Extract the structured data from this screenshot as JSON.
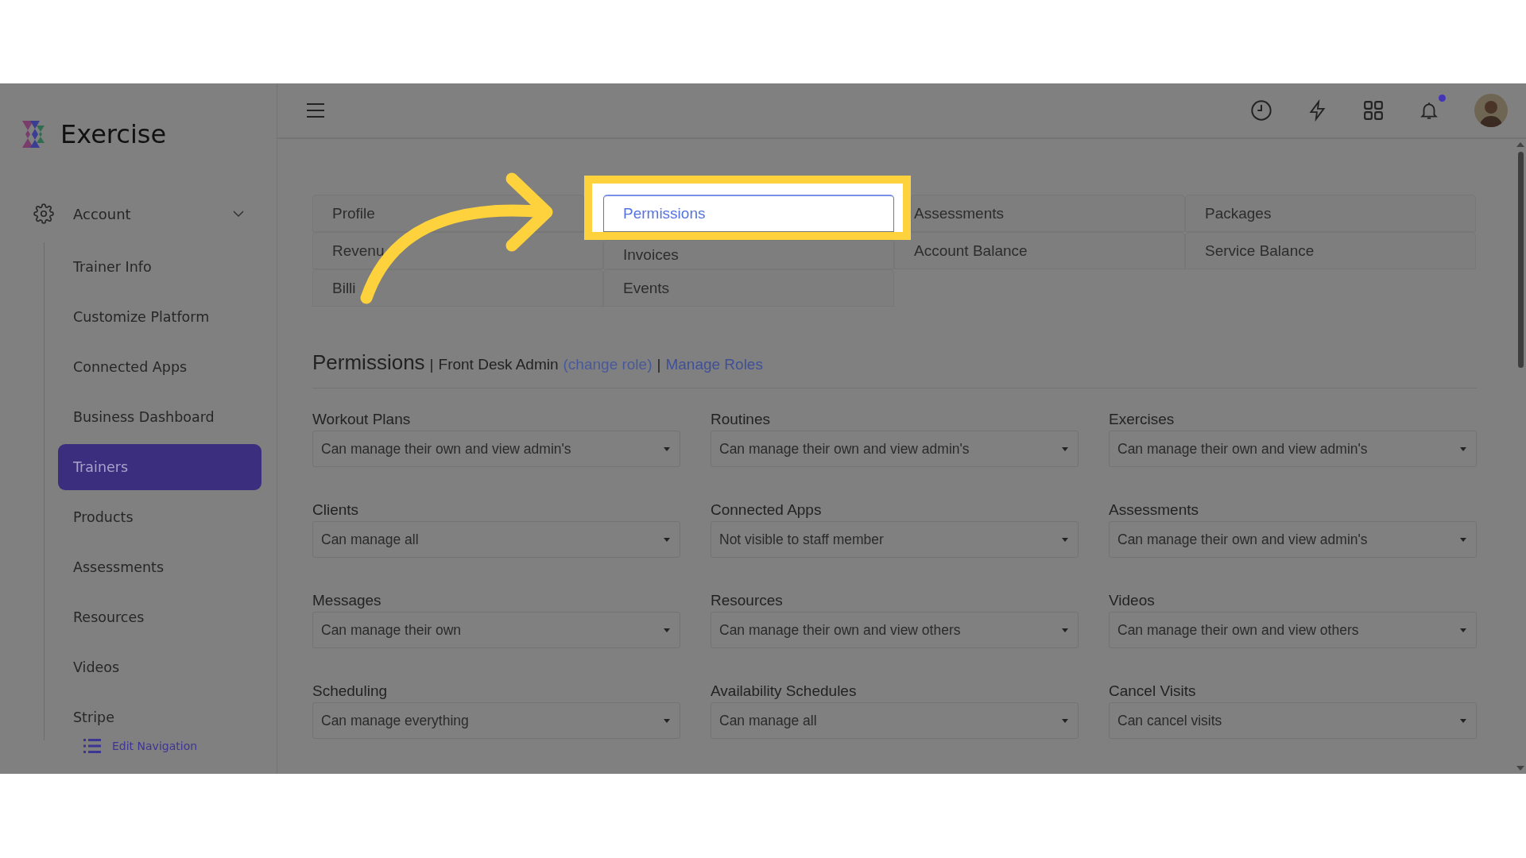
{
  "brand": {
    "name": "Exercise"
  },
  "sidebar": {
    "section": {
      "label": "Account",
      "expanded": true
    },
    "items": [
      {
        "label": "Trainer Info",
        "selected": false
      },
      {
        "label": "Customize Platform",
        "selected": false
      },
      {
        "label": "Connected Apps",
        "selected": false
      },
      {
        "label": "Business Dashboard",
        "selected": false
      },
      {
        "label": "Trainers",
        "selected": true
      },
      {
        "label": "Products",
        "selected": false
      },
      {
        "label": "Assessments",
        "selected": false
      },
      {
        "label": "Resources",
        "selected": false
      },
      {
        "label": "Videos",
        "selected": false
      },
      {
        "label": "Stripe",
        "selected": false
      }
    ],
    "edit_navigation": "Edit Navigation"
  },
  "header": {
    "has_notification": true
  },
  "tabs": [
    {
      "label": "Profile",
      "selected": false
    },
    {
      "label": "Permissions",
      "selected": true
    },
    {
      "label": "Assessments",
      "selected": false
    },
    {
      "label": "Packages",
      "selected": false
    },
    {
      "label": "Revenu",
      "selected": false
    },
    {
      "label": "Invoices",
      "selected": false
    },
    {
      "label": "Account Balance",
      "selected": false
    },
    {
      "label": "Service Balance",
      "selected": false
    },
    {
      "label": "Billi",
      "selected": false
    },
    {
      "label": "Events",
      "selected": false
    }
  ],
  "permissions": {
    "title": "Permissions",
    "separators": [
      "|",
      "|"
    ],
    "role": "Front Desk Admin",
    "change_role": "(change role)",
    "manage_roles": "Manage Roles",
    "fields": [
      {
        "label": "Workout Plans",
        "value": "Can manage their own and view admin's"
      },
      {
        "label": "Routines",
        "value": "Can manage their own and view admin's"
      },
      {
        "label": "Exercises",
        "value": "Can manage their own and view admin's"
      },
      {
        "label": "Clients",
        "value": "Can manage all"
      },
      {
        "label": "Connected Apps",
        "value": "Not visible to staff member"
      },
      {
        "label": "Assessments",
        "value": "Can manage their own and view admin's"
      },
      {
        "label": "Messages",
        "value": "Can manage their own"
      },
      {
        "label": "Resources",
        "value": "Can manage their own and view others"
      },
      {
        "label": "Videos",
        "value": "Can manage their own and view others"
      },
      {
        "label": "Scheduling",
        "value": "Can manage everything"
      },
      {
        "label": "Availability Schedules",
        "value": "Can manage all"
      },
      {
        "label": "Cancel Visits",
        "value": "Can cancel visits"
      }
    ]
  }
}
